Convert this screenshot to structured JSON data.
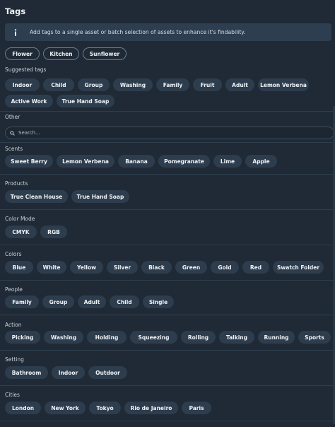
{
  "header": {
    "title": "Tags"
  },
  "info": {
    "text": "Add tags to a single asset or batch selection of assets to enhance it's findability."
  },
  "selected_tags": [
    "Flower",
    "Kitchen",
    "Sunflower"
  ],
  "suggested": {
    "label": "Suggested tags",
    "row1": [
      "Indoor",
      "Child",
      "Group",
      "Washing",
      "Family",
      "Fruit",
      "Adult",
      "Lemon Verbena"
    ],
    "row2": [
      "Active Work",
      "True Hand Soap"
    ]
  },
  "other": {
    "label": "Other"
  },
  "search": {
    "placeholder": "Search..."
  },
  "categories": [
    {
      "label": "Scents",
      "tags": [
        "Sweet Berry",
        "Lemon Verbena",
        "Banana",
        "Pomegranate",
        "Lime",
        "Apple"
      ]
    },
    {
      "label": "Products",
      "tags": [
        "True Clean House",
        "True Hand Soap"
      ]
    },
    {
      "label": "Color Mode",
      "tags": [
        "CMYK",
        "RGB"
      ]
    },
    {
      "label": "Colors",
      "tags": [
        "Blue",
        "White",
        "Yellow",
        "Silver",
        "Black",
        "Green",
        "Gold",
        "Red",
        "Swatch Folder"
      ]
    },
    {
      "label": "People",
      "tags": [
        "Family",
        "Group",
        "Adult",
        "Child",
        "Single"
      ]
    },
    {
      "label": "Action",
      "tags": [
        "Picking",
        "Washing",
        "Holding",
        "Squeezing",
        "Rolling",
        "Talking",
        "Running",
        "Sports"
      ]
    },
    {
      "label": "Setting",
      "tags": [
        "Bathroom",
        "Indoor",
        "Outdoor"
      ]
    },
    {
      "label": "Cities",
      "tags": [
        "London",
        "New York",
        "Tokyo",
        "Rio de Janeiro",
        "Paris"
      ]
    }
  ],
  "colors": {
    "background": "#1f2a36",
    "chip": "#2e3d4d",
    "info_bg": "#2d3e50"
  }
}
